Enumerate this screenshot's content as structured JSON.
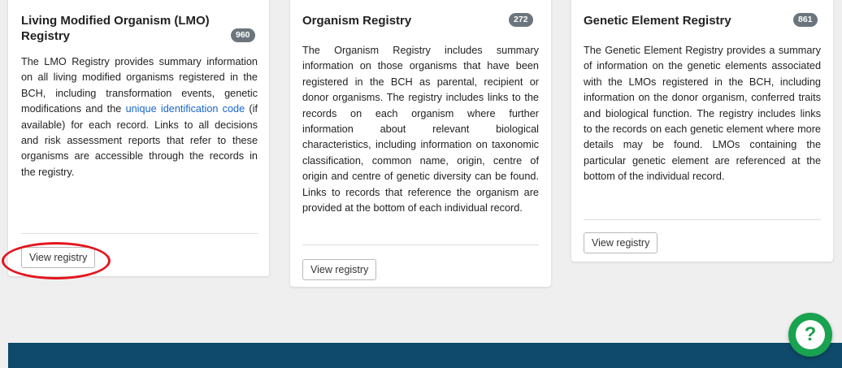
{
  "cards": [
    {
      "title": "Living Modified Organism (LMO) Registry",
      "count": "960",
      "desc_before_link": "The LMO Registry provides summary information on all living modified organisms registered in the BCH, including transformation events, genetic modifications and the ",
      "desc_link": "unique identification code",
      "desc_after_link": " (if available) for each record. Links to all decisions and risk assessment reports that refer to these organisms are accessible through the records in the registry.",
      "button_label": "View registry"
    },
    {
      "title": "Organism Registry",
      "count": "272",
      "desc": "The Organism Registry includes summary information on those organisms that have been registered in the BCH as parental, recipient or donor organisms. The registry includes links to the records on each organism where further information about relevant biological characteristics, including information on taxonomic classification, common name, origin, centre of origin and centre of genetic diversity can be found. Links to records that reference the organism are provided at the bottom of each individual record.",
      "button_label": "View registry"
    },
    {
      "title": "Genetic Element Registry",
      "count": "861",
      "desc": "The Genetic Element Registry provides a summary of information on the genetic elements associated with the LMOs registered in the BCH, including information on the donor organism, conferred traits and biological function. The registry includes links to the records on each genetic element where more details may be found. LMOs containing the particular genetic element are referenced at the bottom of the individual record.",
      "button_label": "View registry"
    }
  ],
  "help_button": {
    "icon": "?"
  },
  "colors": {
    "highlight": "#e4151d",
    "link": "#1a66c9",
    "badge": "#6c757d",
    "footer": "#0f4a6c",
    "help": "#19a24f"
  }
}
